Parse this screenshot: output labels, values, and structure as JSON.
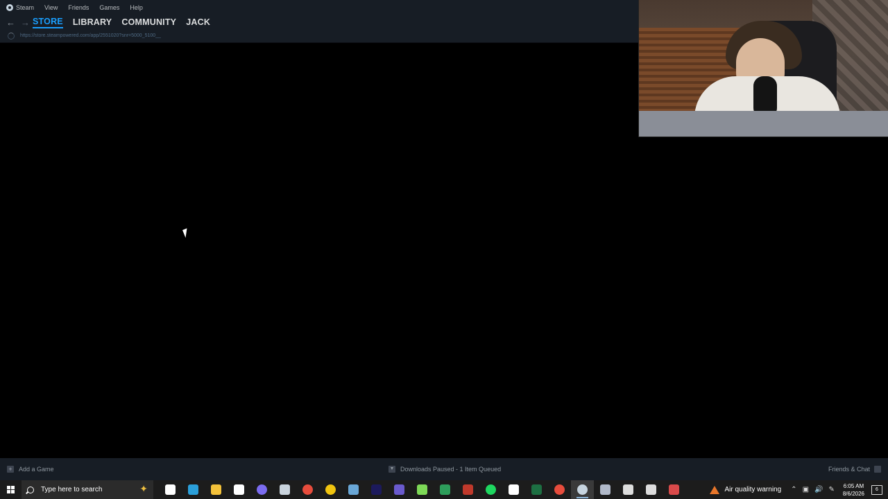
{
  "steam": {
    "menu": [
      "Steam",
      "View",
      "Friends",
      "Games",
      "Help"
    ],
    "tabs": [
      "STORE",
      "LIBRARY",
      "COMMUNITY",
      "JACK"
    ],
    "active_tab": "STORE",
    "url": "https://store.steampowered.com/app/2551020?snr=5000_5100__",
    "bottom": {
      "add_game": "Add a Game",
      "downloads": "Downloads Paused - 1 Item Queued",
      "friends_chat": "Friends & Chat"
    }
  },
  "taskbar": {
    "search_placeholder": "Type here to search",
    "icons": [
      {
        "name": "task-view-icon",
        "color": "#ffffff"
      },
      {
        "name": "edge-icon",
        "color": "#2b9fd9"
      },
      {
        "name": "file-explorer-icon",
        "color": "#f3c13a"
      },
      {
        "name": "microsoft-store-icon",
        "color": "#ffffff"
      },
      {
        "name": "discord-icon",
        "color": "#7b6cf0"
      },
      {
        "name": "onedrive-icon",
        "color": "#c9d3dc"
      },
      {
        "name": "chrome-icon",
        "color": "#e74c3c"
      },
      {
        "name": "chrome-icon",
        "color": "#f1c40f"
      },
      {
        "name": "c-app-icon",
        "color": "#6aa7d6"
      },
      {
        "name": "premiere-icon",
        "color": "#1c1a5c"
      },
      {
        "name": "notes-app-icon",
        "color": "#6a5acd"
      },
      {
        "name": "chat-app-icon",
        "color": "#7ed957"
      },
      {
        "name": "hs-app-icon",
        "color": "#2e9e5b"
      },
      {
        "name": "k-app-icon",
        "color": "#c0392b"
      },
      {
        "name": "spotify-icon",
        "color": "#1ed760"
      },
      {
        "name": "capcut-icon",
        "color": "#ffffff"
      },
      {
        "name": "excel-icon",
        "color": "#1d6f42"
      },
      {
        "name": "chrome-icon",
        "color": "#e74c3c"
      },
      {
        "name": "steam-icon",
        "color": "#c6d4df"
      },
      {
        "name": "shield-app-icon",
        "color": "#b0b8c8"
      },
      {
        "name": "g-app-icon",
        "color": "#dddddd"
      },
      {
        "name": "settings-icon",
        "color": "#dddddd"
      },
      {
        "name": "speed-app-icon",
        "color": "#d94a4a"
      }
    ],
    "active_icon_index": 18,
    "tray": {
      "air_quality": "Air quality warning",
      "time": "6:05 AM",
      "date": "8/6/2026",
      "notifications": "6"
    }
  }
}
